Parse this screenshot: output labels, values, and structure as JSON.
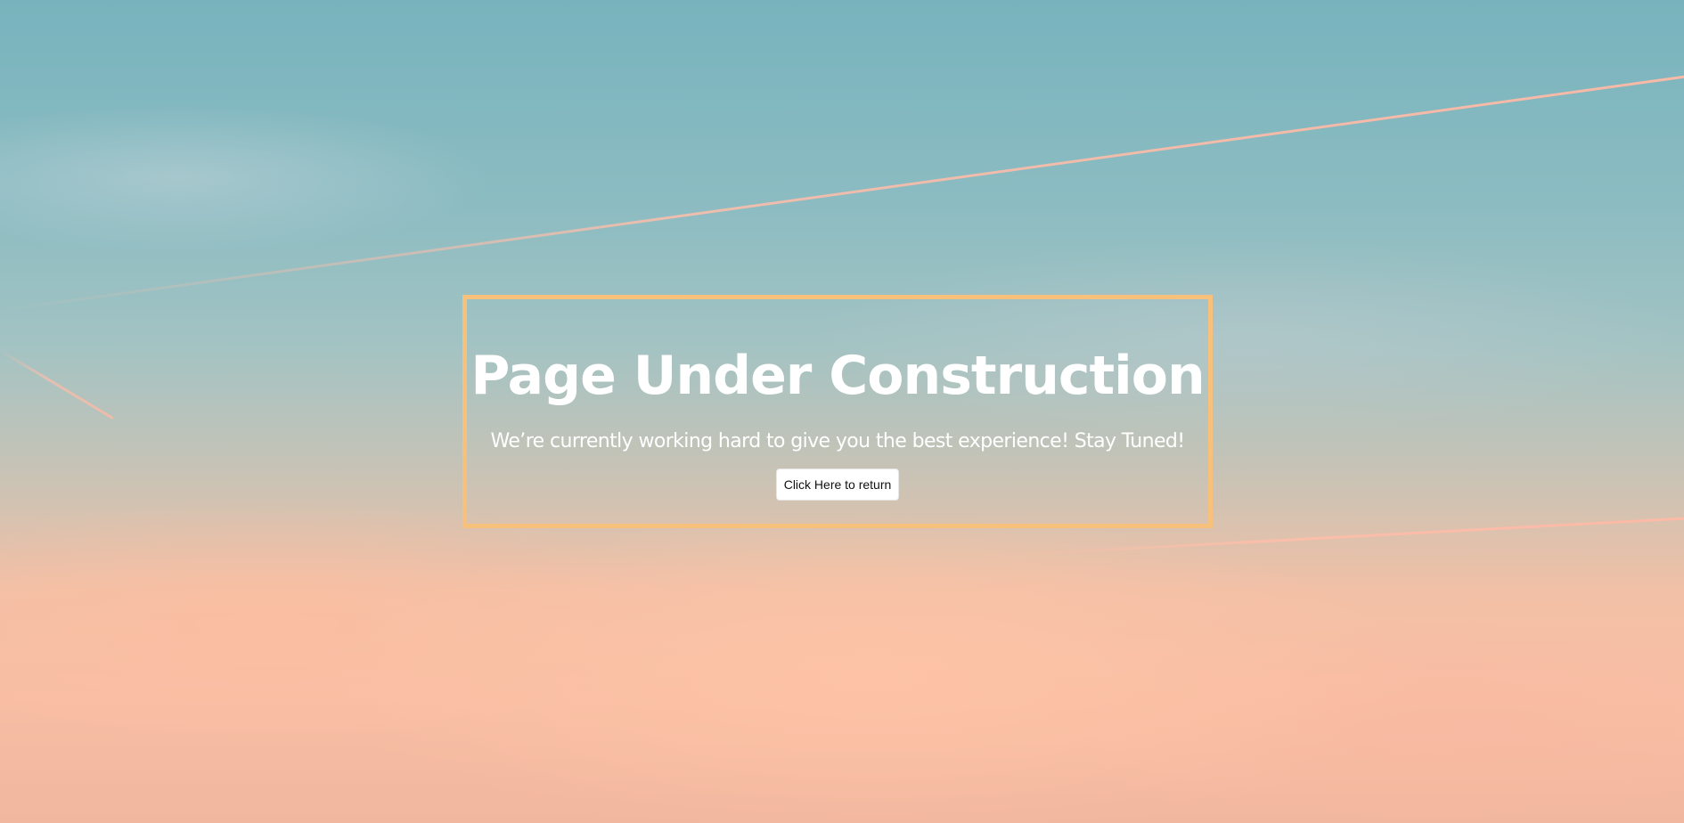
{
  "hero": {
    "title": "Page Under Construction",
    "subtitle": "We’re currently working hard to give you the best experience! Stay Tuned!",
    "button_label": "Click Here to return"
  },
  "colors": {
    "frame_border": "#f7c07b",
    "text": "#ffffff",
    "button_background": "#ffffff",
    "button_text": "#111111"
  }
}
